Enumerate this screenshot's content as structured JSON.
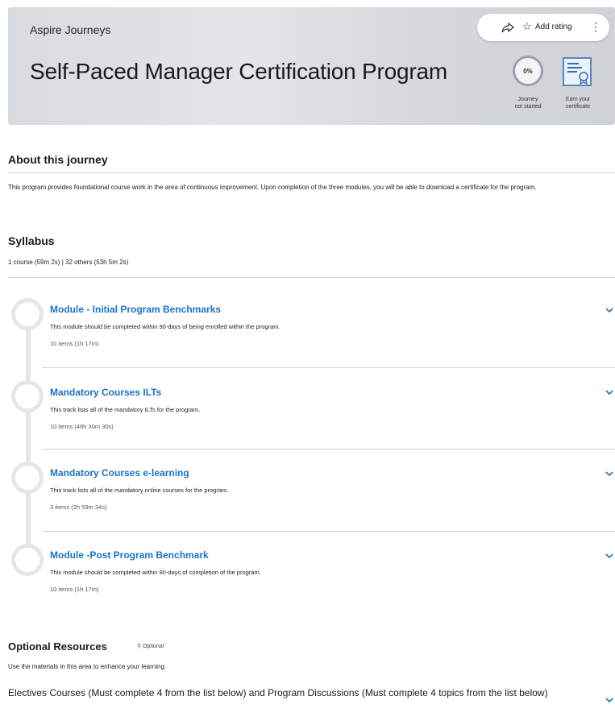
{
  "hero": {
    "brand": "Aspire Journeys",
    "title": "Self-Paced Manager Certification Program",
    "rating_label": "Add rating",
    "progress_value": "0%",
    "progress_fraction": 0,
    "progress_caption_1": "Journey",
    "progress_caption_2": "not started",
    "cert_caption_1": "Earn your",
    "cert_caption_2": "certificate"
  },
  "about": {
    "heading": "About this journey",
    "description": "This program provides foundational course work in the area of continuous improvement. Upon completion of the three modules, you will be able to download a certificate for the program."
  },
  "syllabus": {
    "heading": "Syllabus",
    "summary": "1 course  (59m 2s)  |  32 others  (53h 5m 2s)",
    "modules": [
      {
        "title": "Module - Initial Program Benchmarks",
        "description": "This module should be completed within 90-days of being enrolled within the program.",
        "items": "10 items  (1h 17m)"
      },
      {
        "title": "Mandatory Courses ILTs",
        "description": "This track lists all of the mandatory ILTs for the program.",
        "items": "10 items  (48h 30m 30s)"
      },
      {
        "title": "Mandatory Courses e-learning",
        "description": "This track lists all of the mandatory online courses for the program.",
        "items": "3 items  (2h 59m 34s)"
      },
      {
        "title": "Module -Post Program Benchmark",
        "description": "This module should be completed within 90-days of completion of the program.",
        "items": "10 items  (1h 17m)"
      }
    ]
  },
  "optional": {
    "heading": "Optional Resources",
    "badge": "Optional",
    "description": "Use the materials in this area to enhance your learning.",
    "electives": "Electives Courses (Must complete 4 from the list below) and Program Discussions (Must complete 4 topics from the list below)"
  },
  "icons": [
    "share-icon",
    "star-icon",
    "more-options-icon",
    "certificate-icon",
    "chevron-down-icon",
    "optional-icon"
  ],
  "colors": {
    "accent": "#1a73c9",
    "hero_bg": "#dcdfe2"
  }
}
